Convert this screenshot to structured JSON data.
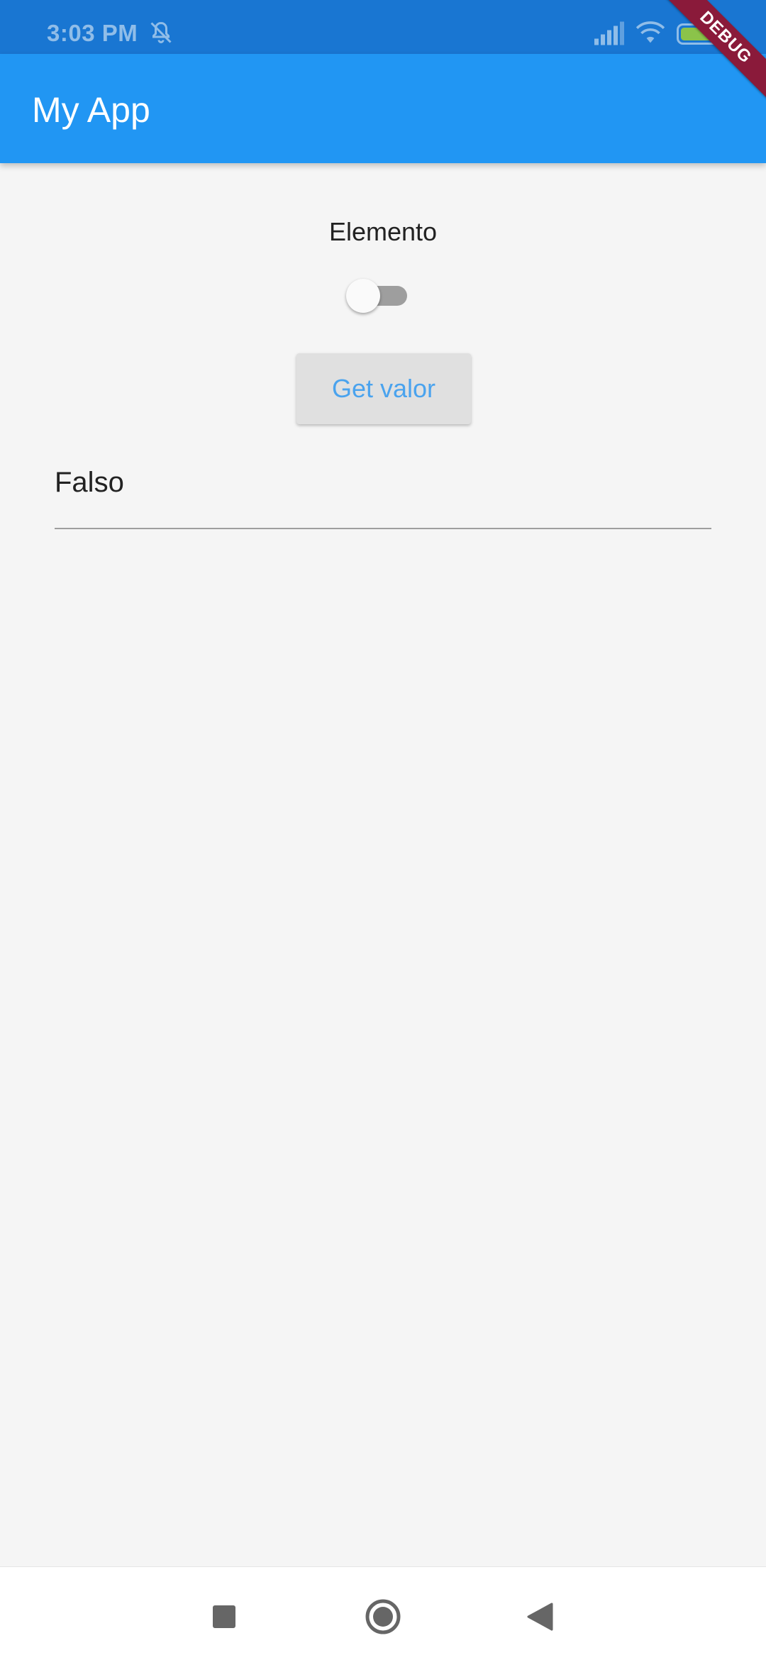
{
  "status_bar": {
    "time": "3:03 PM",
    "icons": [
      "dnd-off-icon",
      "signal-icon",
      "wifi-icon",
      "battery-icon"
    ]
  },
  "debug_banner": "DEBUG",
  "app_bar": {
    "title": "My App",
    "color": "#2196f3"
  },
  "content": {
    "label": "Elemento",
    "switch": {
      "on": false
    },
    "button_label": "Get valor",
    "field_value": "Falso"
  },
  "nav_bar": {
    "icons": [
      "recents-icon",
      "home-icon",
      "back-icon"
    ]
  }
}
